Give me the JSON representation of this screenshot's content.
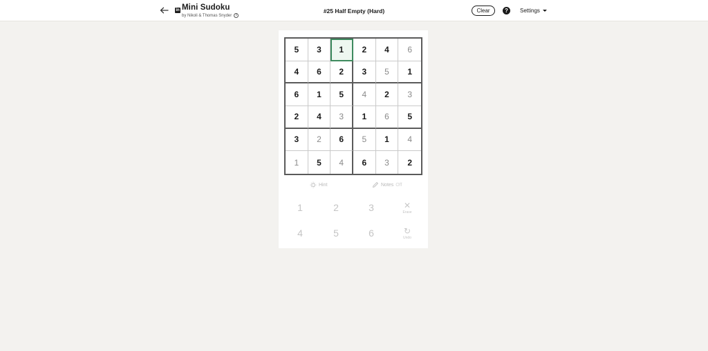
{
  "header": {
    "app_title": "Mini Sudoku",
    "byline": "by Nikoli & Thomas Snyder",
    "brand_logo": "in",
    "puzzle_title": "#25 Half Empty (Hard)",
    "clear_label": "Clear",
    "help_label": "?",
    "settings_label": "Settings"
  },
  "board": {
    "cells": [
      [
        "5",
        "3",
        "1",
        "2",
        "4",
        "6"
      ],
      [
        "4",
        "6",
        "2",
        "3",
        "5",
        "1"
      ],
      [
        "6",
        "1",
        "5",
        "4",
        "2",
        "3"
      ],
      [
        "2",
        "4",
        "3",
        "1",
        "6",
        "5"
      ],
      [
        "3",
        "2",
        "6",
        "5",
        "1",
        "4"
      ],
      [
        "1",
        "5",
        "4",
        "6",
        "3",
        "2"
      ]
    ],
    "user_filled": [
      [
        false,
        false,
        false,
        false,
        false,
        true
      ],
      [
        false,
        false,
        false,
        false,
        true,
        false
      ],
      [
        false,
        false,
        false,
        true,
        false,
        true
      ],
      [
        false,
        false,
        true,
        false,
        true,
        false
      ],
      [
        false,
        true,
        false,
        true,
        false,
        true
      ],
      [
        true,
        false,
        true,
        false,
        true,
        false
      ]
    ],
    "selected": [
      0,
      2
    ],
    "selected_color": "#3d8a5e"
  },
  "tools": {
    "hint_label": "Hint",
    "notes_label": "Notes",
    "notes_state": "Off"
  },
  "keypad": {
    "numbers": [
      "1",
      "2",
      "3",
      "4",
      "5",
      "6"
    ],
    "erase_label": "Erase",
    "undo_label": "Undo"
  },
  "icons": {
    "back": "arrow-left-icon",
    "hint": "lightbulb-icon",
    "notes": "pencil-icon",
    "erase": "close-icon",
    "undo": "undo-icon",
    "settings": "caret-down-icon"
  }
}
